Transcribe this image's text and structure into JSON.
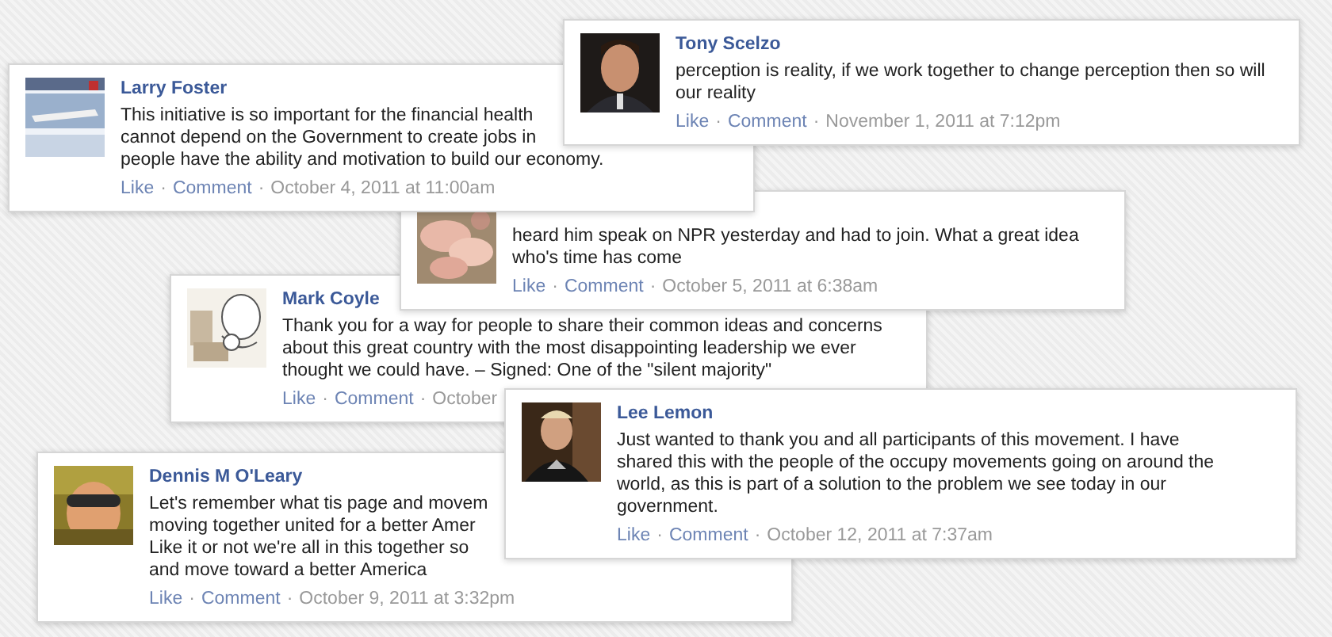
{
  "comments": [
    {
      "author": "Tony Scelzo",
      "lines": [
        "perception is reality, if we work together to change perception then so will",
        "our reality"
      ],
      "meta": [
        {
          "kind": "link",
          "text": "Like"
        },
        {
          "kind": "sep",
          "text": "·"
        },
        {
          "kind": "link",
          "text": "Comment"
        },
        {
          "kind": "sep",
          "text": "·"
        },
        {
          "kind": "time",
          "text": "November 1, 2011 at 7:12pm"
        }
      ]
    },
    {
      "author": "Larry Foster",
      "lines": [
        "This initiative is so important for the financial health",
        "cannot depend on the Government to create jobs in",
        "people have the ability and motivation to build our economy."
      ],
      "meta": [
        {
          "kind": "link",
          "text": "Like"
        },
        {
          "kind": "sep",
          "text": "·"
        },
        {
          "kind": "link",
          "text": "Comment"
        },
        {
          "kind": "sep",
          "text": "·"
        },
        {
          "kind": "time",
          "text": "October 4, 2011 at 11:00am"
        }
      ]
    },
    {
      "lines": [
        "heard him speak on NPR yesterday and had to join. What a great idea",
        "who's time has come"
      ],
      "meta": [
        {
          "kind": "link",
          "text": "Like"
        },
        {
          "kind": "sep",
          "text": "·"
        },
        {
          "kind": "link",
          "text": "Comment"
        },
        {
          "kind": "sep",
          "text": "·"
        },
        {
          "kind": "time",
          "text": "October 5, 2011 at 6:38am"
        }
      ]
    },
    {
      "author": "Mark Coyle",
      "lines": [
        "Thank you for a way for people to share their common ideas and concerns",
        "about this great country with the most disappointing leadership we ever",
        "thought we could have. – Signed: One of the \"silent majority\""
      ],
      "meta": [
        {
          "kind": "link",
          "text": "Like"
        },
        {
          "kind": "sep",
          "text": "·"
        },
        {
          "kind": "link",
          "text": "Comment"
        },
        {
          "kind": "sep",
          "text": "·"
        },
        {
          "kind": "time",
          "text": "October"
        }
      ]
    },
    {
      "author": "Lee Lemon",
      "lines": [
        "Just wanted to thank you and all participants of this movement. I have",
        "shared this with the people of the occupy movements going on around the",
        "world, as this is part of a solution to the problem we see today in our",
        "government."
      ],
      "meta": [
        {
          "kind": "link",
          "text": "Like"
        },
        {
          "kind": "sep",
          "text": "·"
        },
        {
          "kind": "link",
          "text": "Comment"
        },
        {
          "kind": "sep",
          "text": "·"
        },
        {
          "kind": "time",
          "text": "October 12, 2011 at 7:37am"
        }
      ]
    },
    {
      "author": "Dennis M O'Leary",
      "lines": [
        "Let's remember what tis page and movem",
        "moving together united for a better Amer",
        "Like it or not we're all in this together so",
        "and move toward a better America"
      ],
      "meta": [
        {
          "kind": "link",
          "text": "Like"
        },
        {
          "kind": "sep",
          "text": "·"
        },
        {
          "kind": "link",
          "text": "Comment"
        },
        {
          "kind": "sep",
          "text": "·"
        },
        {
          "kind": "time",
          "text": "October 9, 2011 at 3:32pm"
        }
      ]
    }
  ]
}
